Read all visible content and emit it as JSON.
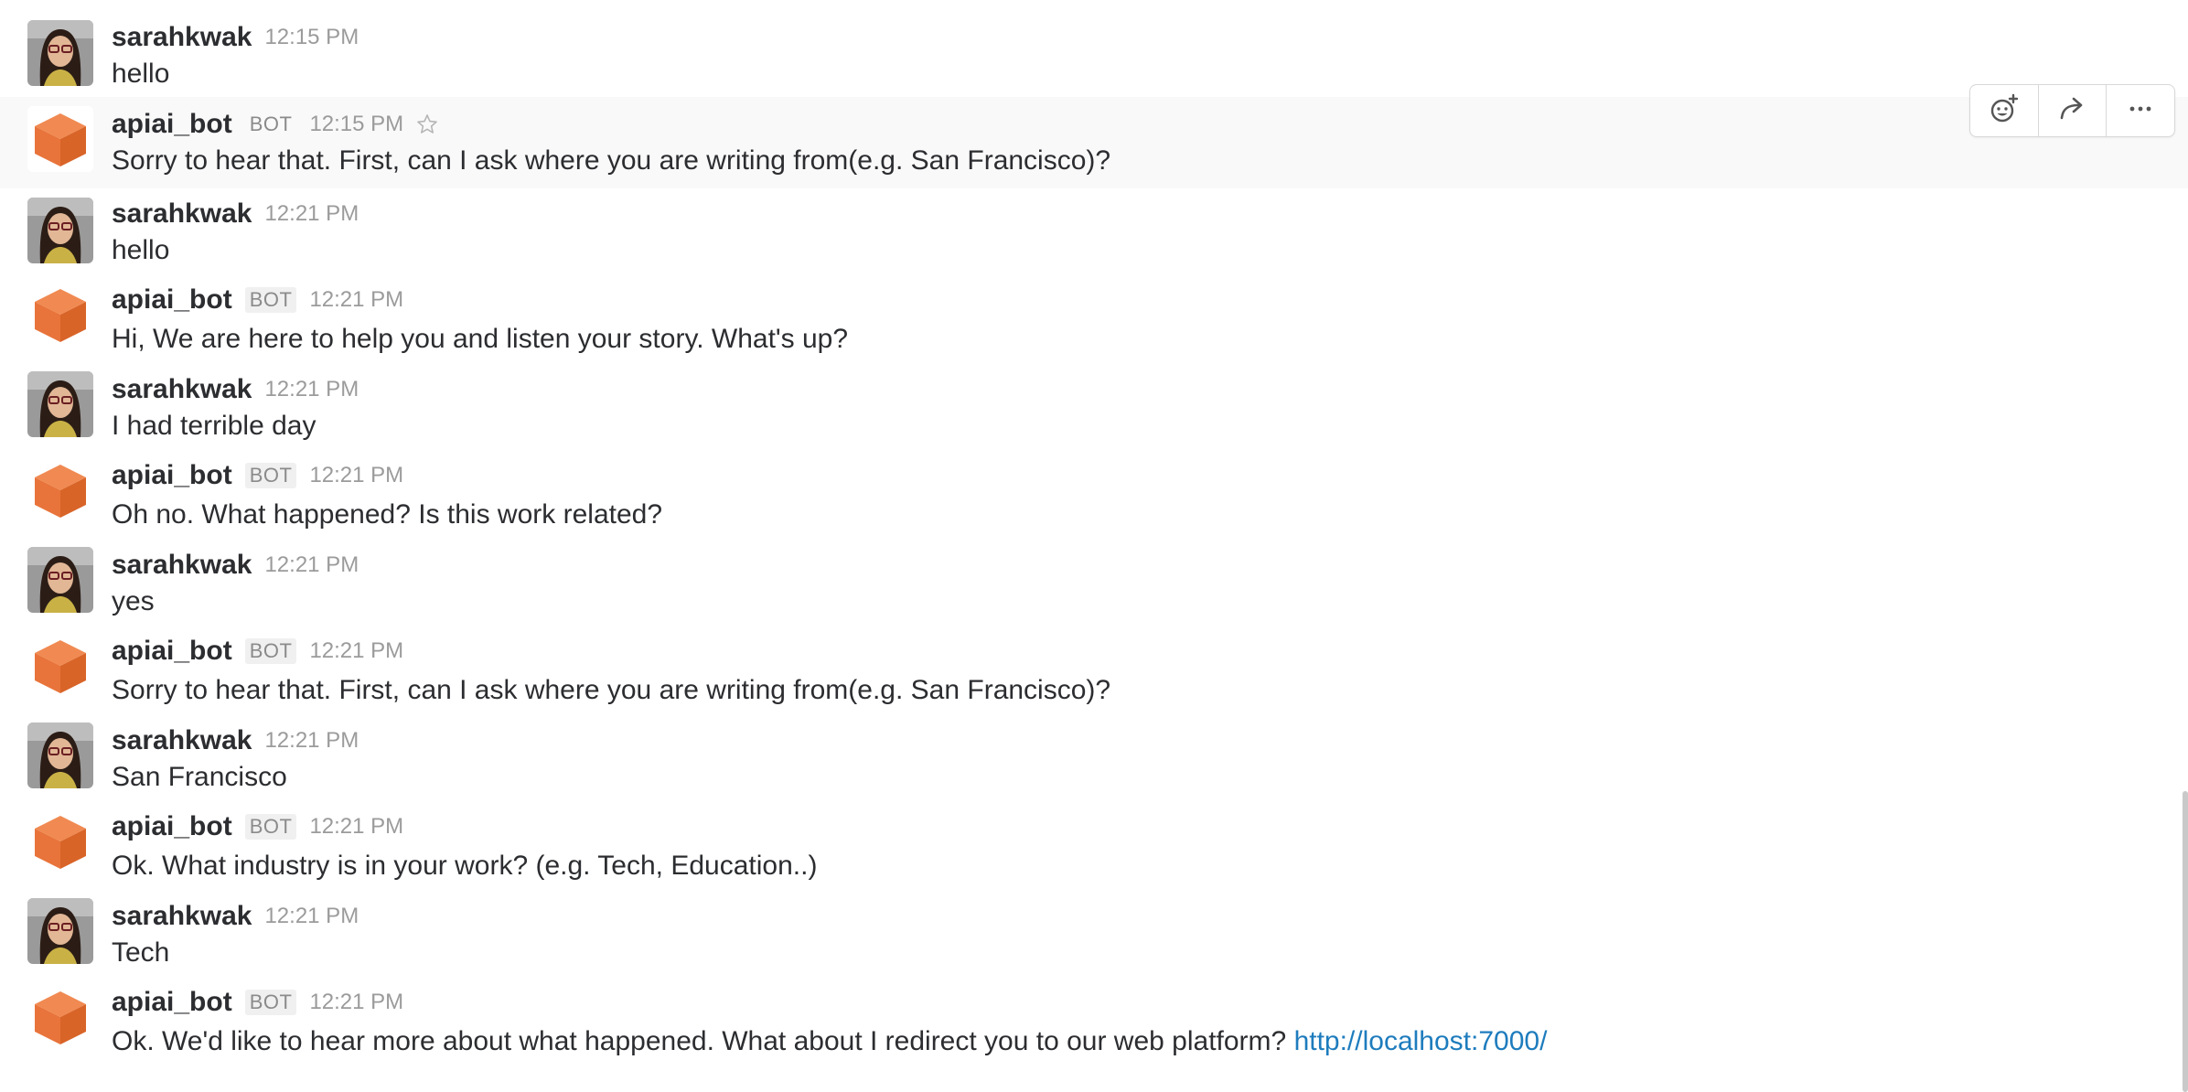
{
  "users": {
    "human": "sarahkwak",
    "bot": "apiai_bot",
    "bot_badge": "BOT"
  },
  "message_actions": {
    "add_reaction": "add-reaction-icon",
    "share": "share-icon",
    "more": "more-actions-icon"
  },
  "messages": [
    {
      "author": "sarahkwak",
      "time": "12:15 PM",
      "text": "hello"
    },
    {
      "author": "apiai_bot",
      "badge": "BOT",
      "time": "12:15 PM",
      "text": "Sorry to hear that. First, can I ask where you are writing from(e.g. San Francisco)?"
    },
    {
      "author": "sarahkwak",
      "time": "12:21 PM",
      "text": "hello"
    },
    {
      "author": "apiai_bot",
      "badge": "BOT",
      "time": "12:21 PM",
      "text": "Hi, We are here to help you and listen your story. What's up?"
    },
    {
      "author": "sarahkwak",
      "time": "12:21 PM",
      "text": "I had terrible day"
    },
    {
      "author": "apiai_bot",
      "badge": "BOT",
      "time": "12:21 PM",
      "text": "Oh no. What happened? Is this work related?"
    },
    {
      "author": "sarahkwak",
      "time": "12:21 PM",
      "text": "yes"
    },
    {
      "author": "apiai_bot",
      "badge": "BOT",
      "time": "12:21 PM",
      "text": "Sorry to hear that. First, can I ask where you are writing from(e.g. San Francisco)?"
    },
    {
      "author": "sarahkwak",
      "time": "12:21 PM",
      "text": "San Francisco"
    },
    {
      "author": "apiai_bot",
      "badge": "BOT",
      "time": "12:21 PM",
      "text": "Ok. What industry is in your work? (e.g. Tech, Education..)"
    },
    {
      "author": "sarahkwak",
      "time": "12:21 PM",
      "text": "Tech"
    },
    {
      "author": "apiai_bot",
      "badge": "BOT",
      "time": "12:21 PM",
      "text": "Ok. We'd like to hear more about what happened. What about I redirect you to our web platform? ",
      "link": "http://localhost:7000/"
    }
  ],
  "colors": {
    "bot_avatar": "#e8743b",
    "link": "#1e7cbd",
    "hover_bg": "#f9f9f9"
  }
}
